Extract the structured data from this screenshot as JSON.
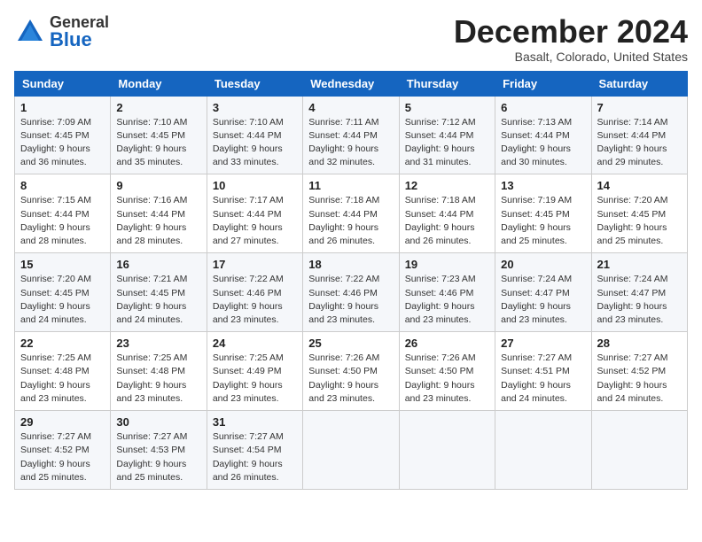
{
  "header": {
    "logo_general": "General",
    "logo_blue": "Blue",
    "month_title": "December 2024",
    "subtitle": "Basalt, Colorado, United States"
  },
  "calendar": {
    "days_of_week": [
      "Sunday",
      "Monday",
      "Tuesday",
      "Wednesday",
      "Thursday",
      "Friday",
      "Saturday"
    ],
    "weeks": [
      [
        null,
        {
          "day": "2",
          "sunrise": "Sunrise: 7:10 AM",
          "sunset": "Sunset: 4:45 PM",
          "daylight": "Daylight: 9 hours and 35 minutes."
        },
        {
          "day": "3",
          "sunrise": "Sunrise: 7:10 AM",
          "sunset": "Sunset: 4:44 PM",
          "daylight": "Daylight: 9 hours and 33 minutes."
        },
        {
          "day": "4",
          "sunrise": "Sunrise: 7:11 AM",
          "sunset": "Sunset: 4:44 PM",
          "daylight": "Daylight: 9 hours and 32 minutes."
        },
        {
          "day": "5",
          "sunrise": "Sunrise: 7:12 AM",
          "sunset": "Sunset: 4:44 PM",
          "daylight": "Daylight: 9 hours and 31 minutes."
        },
        {
          "day": "6",
          "sunrise": "Sunrise: 7:13 AM",
          "sunset": "Sunset: 4:44 PM",
          "daylight": "Daylight: 9 hours and 30 minutes."
        },
        {
          "day": "7",
          "sunrise": "Sunrise: 7:14 AM",
          "sunset": "Sunset: 4:44 PM",
          "daylight": "Daylight: 9 hours and 29 minutes."
        }
      ],
      [
        {
          "day": "1",
          "sunrise": "Sunrise: 7:09 AM",
          "sunset": "Sunset: 4:45 PM",
          "daylight": "Daylight: 9 hours and 36 minutes."
        },
        {
          "day": "9",
          "sunrise": "Sunrise: 7:16 AM",
          "sunset": "Sunset: 4:44 PM",
          "daylight": "Daylight: 9 hours and 28 minutes."
        },
        {
          "day": "10",
          "sunrise": "Sunrise: 7:17 AM",
          "sunset": "Sunset: 4:44 PM",
          "daylight": "Daylight: 9 hours and 27 minutes."
        },
        {
          "day": "11",
          "sunrise": "Sunrise: 7:18 AM",
          "sunset": "Sunset: 4:44 PM",
          "daylight": "Daylight: 9 hours and 26 minutes."
        },
        {
          "day": "12",
          "sunrise": "Sunrise: 7:18 AM",
          "sunset": "Sunset: 4:44 PM",
          "daylight": "Daylight: 9 hours and 26 minutes."
        },
        {
          "day": "13",
          "sunrise": "Sunrise: 7:19 AM",
          "sunset": "Sunset: 4:45 PM",
          "daylight": "Daylight: 9 hours and 25 minutes."
        },
        {
          "day": "14",
          "sunrise": "Sunrise: 7:20 AM",
          "sunset": "Sunset: 4:45 PM",
          "daylight": "Daylight: 9 hours and 25 minutes."
        }
      ],
      [
        {
          "day": "8",
          "sunrise": "Sunrise: 7:15 AM",
          "sunset": "Sunset: 4:44 PM",
          "daylight": "Daylight: 9 hours and 28 minutes."
        },
        {
          "day": "16",
          "sunrise": "Sunrise: 7:21 AM",
          "sunset": "Sunset: 4:45 PM",
          "daylight": "Daylight: 9 hours and 24 minutes."
        },
        {
          "day": "17",
          "sunrise": "Sunrise: 7:22 AM",
          "sunset": "Sunset: 4:46 PM",
          "daylight": "Daylight: 9 hours and 23 minutes."
        },
        {
          "day": "18",
          "sunrise": "Sunrise: 7:22 AM",
          "sunset": "Sunset: 4:46 PM",
          "daylight": "Daylight: 9 hours and 23 minutes."
        },
        {
          "day": "19",
          "sunrise": "Sunrise: 7:23 AM",
          "sunset": "Sunset: 4:46 PM",
          "daylight": "Daylight: 9 hours and 23 minutes."
        },
        {
          "day": "20",
          "sunrise": "Sunrise: 7:24 AM",
          "sunset": "Sunset: 4:47 PM",
          "daylight": "Daylight: 9 hours and 23 minutes."
        },
        {
          "day": "21",
          "sunrise": "Sunrise: 7:24 AM",
          "sunset": "Sunset: 4:47 PM",
          "daylight": "Daylight: 9 hours and 23 minutes."
        }
      ],
      [
        {
          "day": "15",
          "sunrise": "Sunrise: 7:20 AM",
          "sunset": "Sunset: 4:45 PM",
          "daylight": "Daylight: 9 hours and 24 minutes."
        },
        {
          "day": "23",
          "sunrise": "Sunrise: 7:25 AM",
          "sunset": "Sunset: 4:48 PM",
          "daylight": "Daylight: 9 hours and 23 minutes."
        },
        {
          "day": "24",
          "sunrise": "Sunrise: 7:25 AM",
          "sunset": "Sunset: 4:49 PM",
          "daylight": "Daylight: 9 hours and 23 minutes."
        },
        {
          "day": "25",
          "sunrise": "Sunrise: 7:26 AM",
          "sunset": "Sunset: 4:50 PM",
          "daylight": "Daylight: 9 hours and 23 minutes."
        },
        {
          "day": "26",
          "sunrise": "Sunrise: 7:26 AM",
          "sunset": "Sunset: 4:50 PM",
          "daylight": "Daylight: 9 hours and 23 minutes."
        },
        {
          "day": "27",
          "sunrise": "Sunrise: 7:27 AM",
          "sunset": "Sunset: 4:51 PM",
          "daylight": "Daylight: 9 hours and 24 minutes."
        },
        {
          "day": "28",
          "sunrise": "Sunrise: 7:27 AM",
          "sunset": "Sunset: 4:52 PM",
          "daylight": "Daylight: 9 hours and 24 minutes."
        }
      ],
      [
        {
          "day": "22",
          "sunrise": "Sunrise: 7:25 AM",
          "sunset": "Sunset: 4:48 PM",
          "daylight": "Daylight: 9 hours and 23 minutes."
        },
        {
          "day": "30",
          "sunrise": "Sunrise: 7:27 AM",
          "sunset": "Sunset: 4:53 PM",
          "daylight": "Daylight: 9 hours and 25 minutes."
        },
        {
          "day": "31",
          "sunrise": "Sunrise: 7:27 AM",
          "sunset": "Sunset: 4:54 PM",
          "daylight": "Daylight: 9 hours and 26 minutes."
        },
        null,
        null,
        null,
        null
      ],
      [
        {
          "day": "29",
          "sunrise": "Sunrise: 7:27 AM",
          "sunset": "Sunset: 4:52 PM",
          "daylight": "Daylight: 9 hours and 25 minutes."
        },
        null,
        null,
        null,
        null,
        null,
        null
      ]
    ]
  }
}
